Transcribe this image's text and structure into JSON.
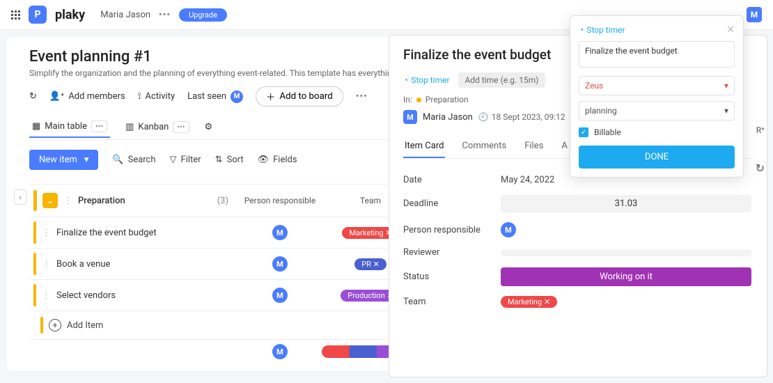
{
  "header": {
    "logo_text": "plaky",
    "logo_badge": "P",
    "user_name": "Maria Jason",
    "upgrade_label": "Upgrade",
    "user_badge": "M"
  },
  "board": {
    "title": "Event planning #1",
    "description": "Simplify the organization and the planning of everything event-related. This template has everything you need",
    "tools": {
      "add_members": "Add members",
      "activity": "Activity",
      "last_seen": "Last seen",
      "last_seen_badge": "M",
      "add_to_board": "Add to board"
    },
    "views": {
      "main_table": "Main table",
      "kanban": "Kanban"
    },
    "actions": {
      "new_item": "New item",
      "search": "Search",
      "filter": "Filter",
      "sort": "Sort",
      "fields": "Fields"
    }
  },
  "table": {
    "group_name": "Preparation",
    "count": "(3)",
    "columns": {
      "person": "Person responsible",
      "team": "Team"
    },
    "rows": [
      {
        "name": "Finalize the event budget",
        "person": "M",
        "team": "Marketing ✕",
        "team_class": "badge-marketing"
      },
      {
        "name": "Book a venue",
        "person": "M",
        "team": "PR ✕",
        "team_class": "badge-pr"
      },
      {
        "name": "Select vendors",
        "person": "M",
        "team": "Production ✕",
        "team_class": "badge-production"
      }
    ],
    "add_item": "Add Item",
    "summary_person": "M"
  },
  "detail": {
    "title": "Finalize the event budget",
    "stop_timer": "Stop timer",
    "add_time_placeholder": "Add time (e.g. 15m)",
    "in_label": "In:",
    "group": "Preparation",
    "person_badge": "M",
    "person_name": "Maria Jason",
    "timestamp": "18 Sept 2023, 09:12",
    "tabs": {
      "item_card": "Item Card",
      "comments": "Comments",
      "files": "Files",
      "more": "A"
    },
    "fields": {
      "date": {
        "label": "Date",
        "value": "May 24, 2022"
      },
      "deadline": {
        "label": "Deadline",
        "value": "31.03"
      },
      "person": {
        "label": "Person responsible",
        "badge": "M"
      },
      "reviewer": {
        "label": "Reviewer",
        "value": ""
      },
      "status": {
        "label": "Status",
        "value": "Working on it"
      },
      "team": {
        "label": "Team",
        "value": "Marketing ✕"
      }
    }
  },
  "timer": {
    "header": "Stop timer",
    "task_text": "Finalize the event budget",
    "project": "Zeus",
    "tag": "planning",
    "billable_label": "Billable",
    "done_label": "DONE"
  }
}
